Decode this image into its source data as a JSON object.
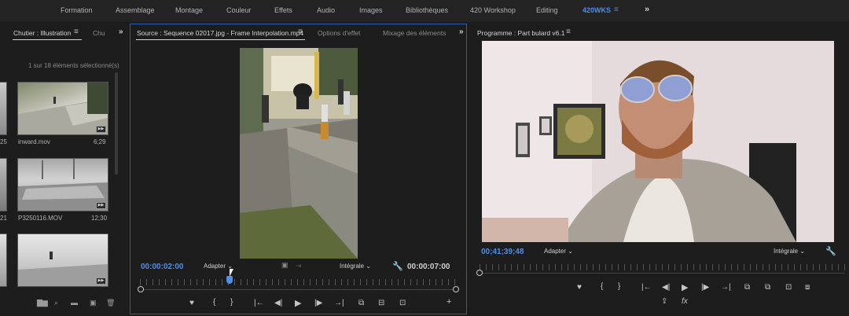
{
  "workspaces": [
    "Formation",
    "Assemblage",
    "Montage",
    "Couleur",
    "Effets",
    "Audio",
    "Images",
    "Bibliothèques",
    "420 Workshop",
    "Editing",
    "420WKS"
  ],
  "workspace_menu_icon": "≡",
  "workspace_more_icon": "»",
  "bin_panel": {
    "tab_active": "Chutier : Illustration",
    "tab_menu": "≡",
    "tab_other": "Chu",
    "more": "»",
    "status": "1 sur 18 éléments sélectionné(s)",
    "clips": [
      {
        "name": "inward.mov",
        "duration": "6;29"
      },
      {
        "name": "P3250116.MOV",
        "duration": "12;30"
      },
      {
        "name": "",
        "duration": ""
      }
    ],
    "partial_durations": [
      "25",
      "21"
    ],
    "footer_icons": [
      "new-bin-icon",
      "search-icon",
      "folder-icon",
      "new-item-icon",
      "trash-icon"
    ]
  },
  "source_panel": {
    "tab_active": "Source : Sequence 02017.jpg - Frame Interpolation.mp4",
    "tab_menu": "≡",
    "tab_effect_options": "Options d'effet",
    "tab_audio_mixer": "Mixage des éléments",
    "more": "»",
    "timecode_current": "00:00:02:00",
    "timecode_duration": "00:00:07:00",
    "zoom_dropdown": "Adapter",
    "quality_dropdown": "Intégrale",
    "playhead_fraction": 0.28
  },
  "program_panel": {
    "tab_active": "Programme : Part bulard v6.1",
    "tab_menu": "≡",
    "timecode_current": "00;41;39;48",
    "zoom_dropdown": "Adapter",
    "quality_dropdown": "Intégrale"
  },
  "transport": {
    "marker": "♥",
    "in": "{",
    "out": "}",
    "go_in": "|←",
    "step_back": "◀|",
    "play": "▶",
    "step_fwd": "|▶",
    "go_out": "→|",
    "add": "+",
    "fx": "fx"
  },
  "colors": {
    "accent": "#4f8fe8",
    "panel": "#1d1d1d",
    "border_active": "#2a5fa8"
  }
}
